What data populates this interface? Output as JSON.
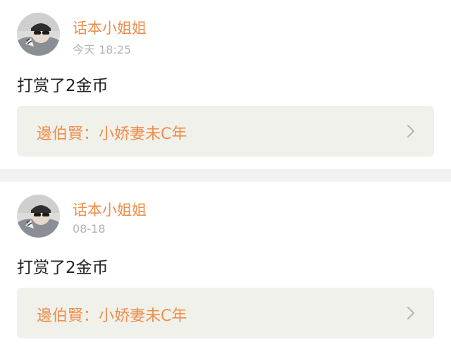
{
  "posts": [
    {
      "username": "话本小姐姐",
      "time": "今天 18:25",
      "content": "打赏了2金币",
      "reference": "邊伯賢：小娇妻未C年",
      "chevron_icon": "chevron-right-icon"
    },
    {
      "username": "话本小姐姐",
      "time": "08-18",
      "content": "打赏了2金币",
      "reference": "邊伯賢：小娇妻未C年",
      "chevron_icon": "chevron-right-icon"
    }
  ],
  "colors": {
    "accent": "#ef8d4b",
    "timestamp": "#b3b3b3",
    "text": "#222222",
    "reference_bg": "#f0f1ea",
    "separator": "#f2f2f2"
  }
}
